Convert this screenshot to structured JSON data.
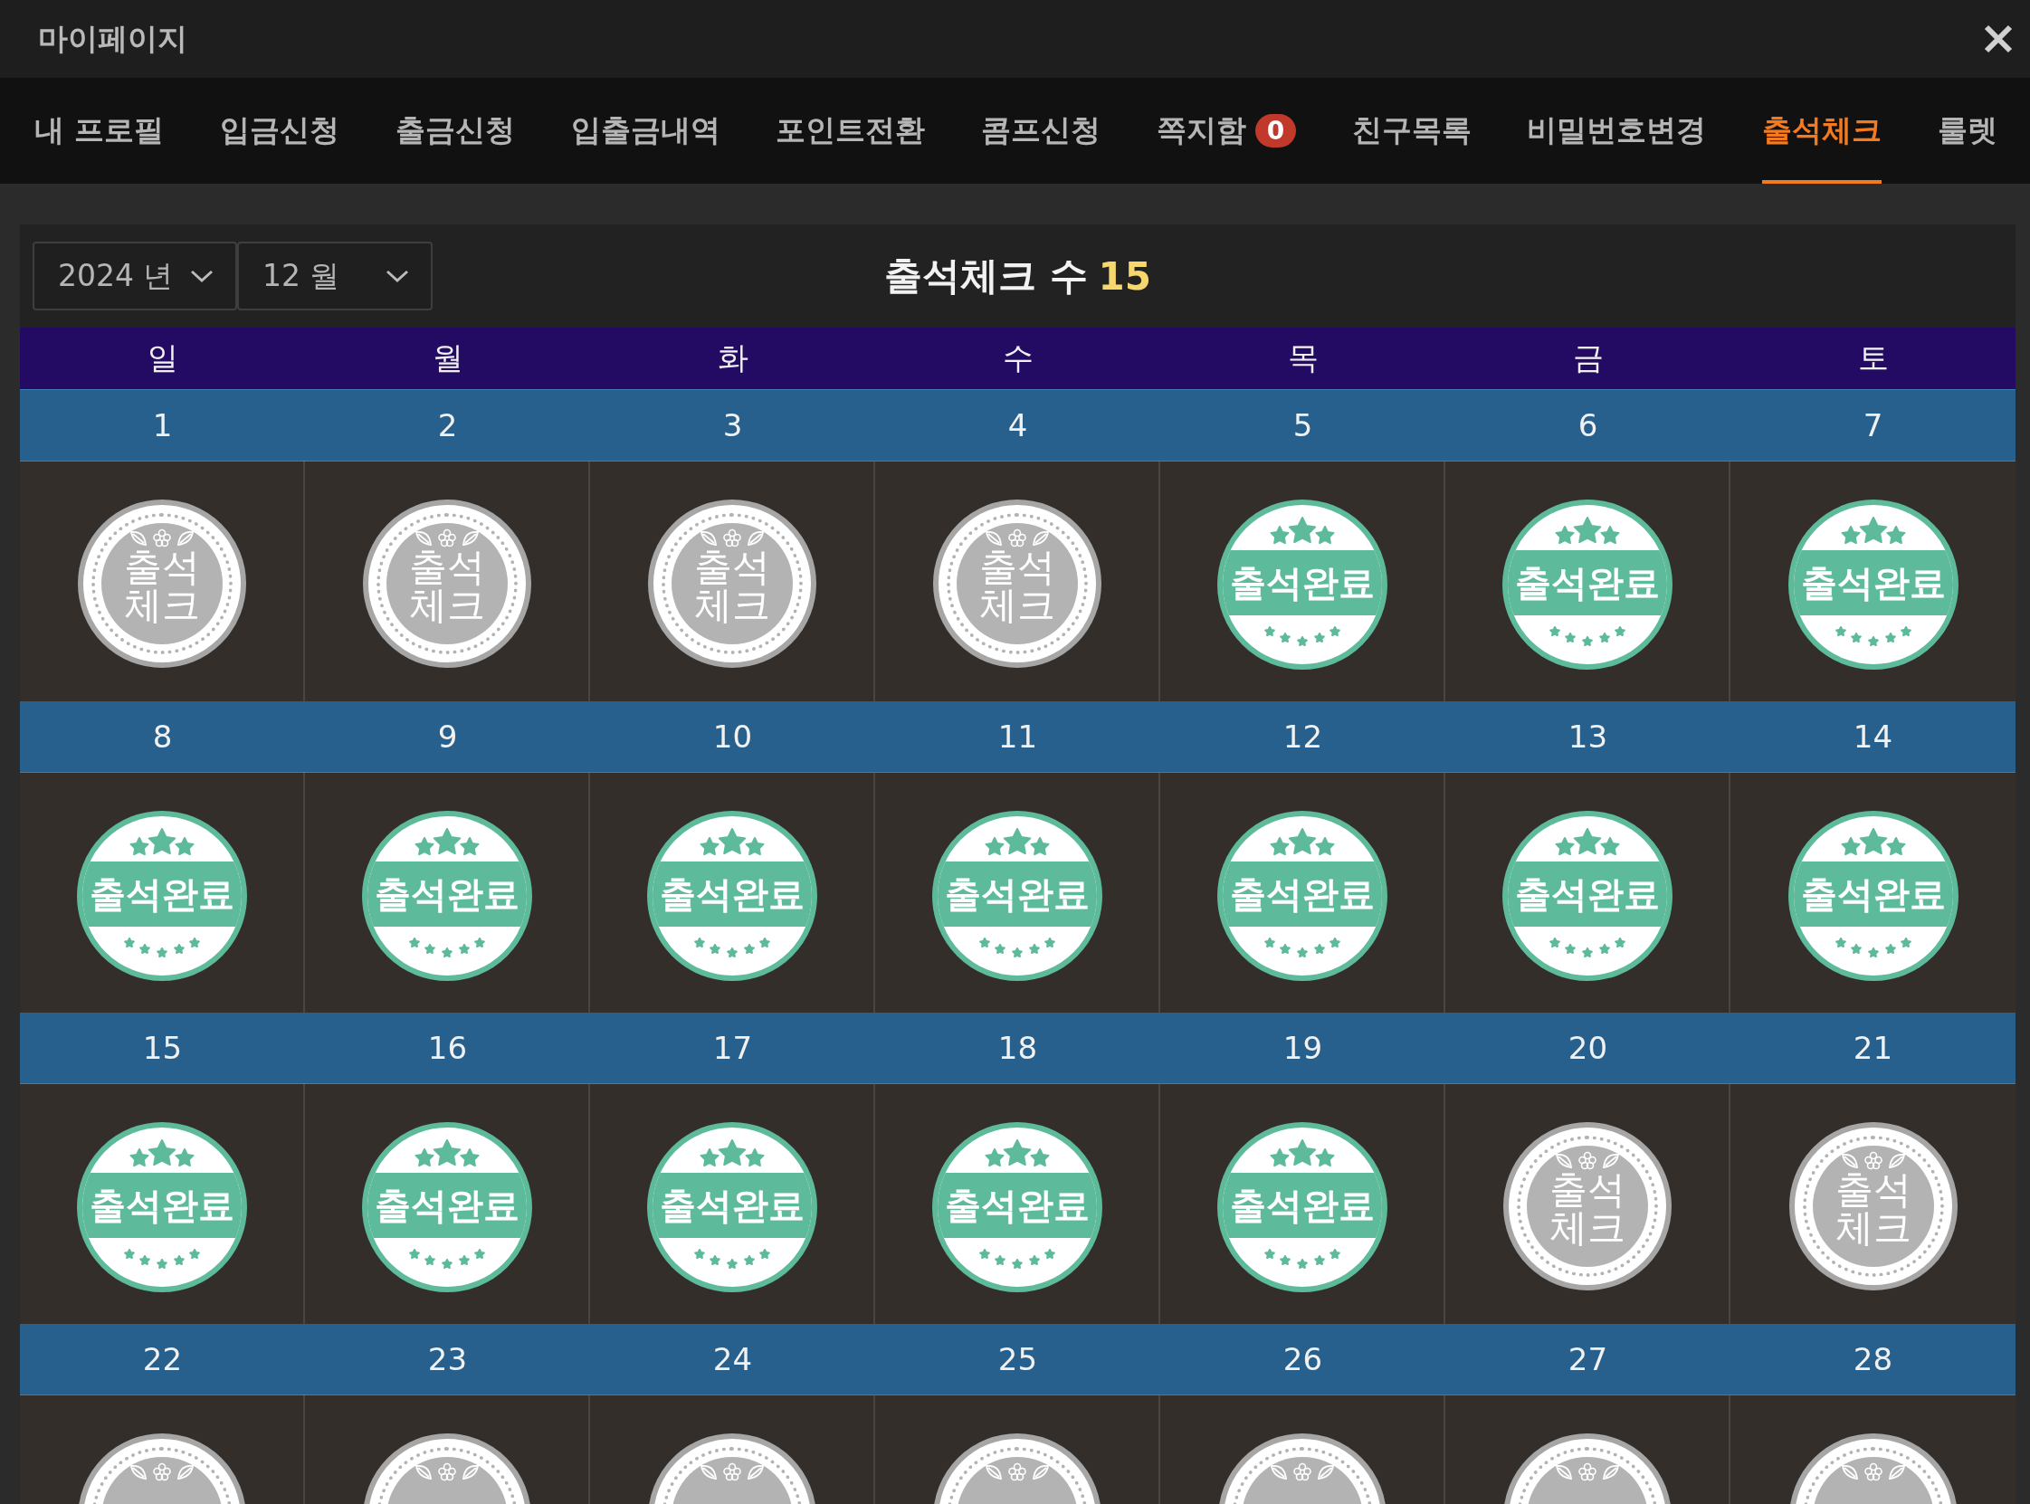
{
  "window": {
    "title": "마이페이지"
  },
  "tabs": [
    {
      "label": "내 프로필",
      "selected": false
    },
    {
      "label": "입금신청",
      "selected": false
    },
    {
      "label": "출금신청",
      "selected": false
    },
    {
      "label": "입출금내역",
      "selected": false
    },
    {
      "label": "포인트전환",
      "selected": false
    },
    {
      "label": "콤프신청",
      "selected": false
    },
    {
      "label": "쪽지함",
      "selected": false,
      "badge": "0"
    },
    {
      "label": "친구목록",
      "selected": false
    },
    {
      "label": "비밀번호변경",
      "selected": false
    },
    {
      "label": "출석체크",
      "selected": true
    },
    {
      "label": "룰렛",
      "selected": false
    }
  ],
  "filters": {
    "year": "2024 년",
    "month": "12 월"
  },
  "summary": {
    "label": "출석체크 수",
    "count": "15"
  },
  "weekdays": [
    "일",
    "월",
    "화",
    "수",
    "목",
    "금",
    "토"
  ],
  "weeks": [
    [
      {
        "date": "1",
        "checked": false,
        "stamp_lines": [
          "출석",
          "체크"
        ]
      },
      {
        "date": "2",
        "checked": false,
        "stamp_lines": [
          "출석",
          "체크"
        ]
      },
      {
        "date": "3",
        "checked": false,
        "stamp_lines": [
          "출석",
          "체크"
        ]
      },
      {
        "date": "4",
        "checked": false,
        "stamp_lines": [
          "출석",
          "체크"
        ]
      },
      {
        "date": "5",
        "checked": true,
        "stamp_lines": [
          "출석완료"
        ]
      },
      {
        "date": "6",
        "checked": true,
        "stamp_lines": [
          "출석완료"
        ]
      },
      {
        "date": "7",
        "checked": true,
        "stamp_lines": [
          "출석완료"
        ]
      }
    ],
    [
      {
        "date": "8",
        "checked": true,
        "stamp_lines": [
          "출석완료"
        ]
      },
      {
        "date": "9",
        "checked": true,
        "stamp_lines": [
          "출석완료"
        ]
      },
      {
        "date": "10",
        "checked": true,
        "stamp_lines": [
          "출석완료"
        ]
      },
      {
        "date": "11",
        "checked": true,
        "stamp_lines": [
          "출석완료"
        ]
      },
      {
        "date": "12",
        "checked": true,
        "stamp_lines": [
          "출석완료"
        ]
      },
      {
        "date": "13",
        "checked": true,
        "stamp_lines": [
          "출석완료"
        ]
      },
      {
        "date": "14",
        "checked": true,
        "stamp_lines": [
          "출석완료"
        ]
      }
    ],
    [
      {
        "date": "15",
        "checked": true,
        "stamp_lines": [
          "출석완료"
        ]
      },
      {
        "date": "16",
        "checked": true,
        "stamp_lines": [
          "출석완료"
        ]
      },
      {
        "date": "17",
        "checked": true,
        "stamp_lines": [
          "출석완료"
        ]
      },
      {
        "date": "18",
        "checked": true,
        "stamp_lines": [
          "출석완료"
        ]
      },
      {
        "date": "19",
        "checked": true,
        "stamp_lines": [
          "출석완료"
        ]
      },
      {
        "date": "20",
        "checked": false,
        "stamp_lines": [
          "출석",
          "체크"
        ]
      },
      {
        "date": "21",
        "checked": false,
        "stamp_lines": [
          "출석",
          "체크"
        ]
      }
    ],
    [
      {
        "date": "22",
        "checked": false
      },
      {
        "date": "23",
        "checked": false
      },
      {
        "date": "24",
        "checked": false
      },
      {
        "date": "25",
        "checked": false
      },
      {
        "date": "26",
        "checked": false
      },
      {
        "date": "27",
        "checked": false
      },
      {
        "date": "28",
        "checked": false
      }
    ]
  ]
}
